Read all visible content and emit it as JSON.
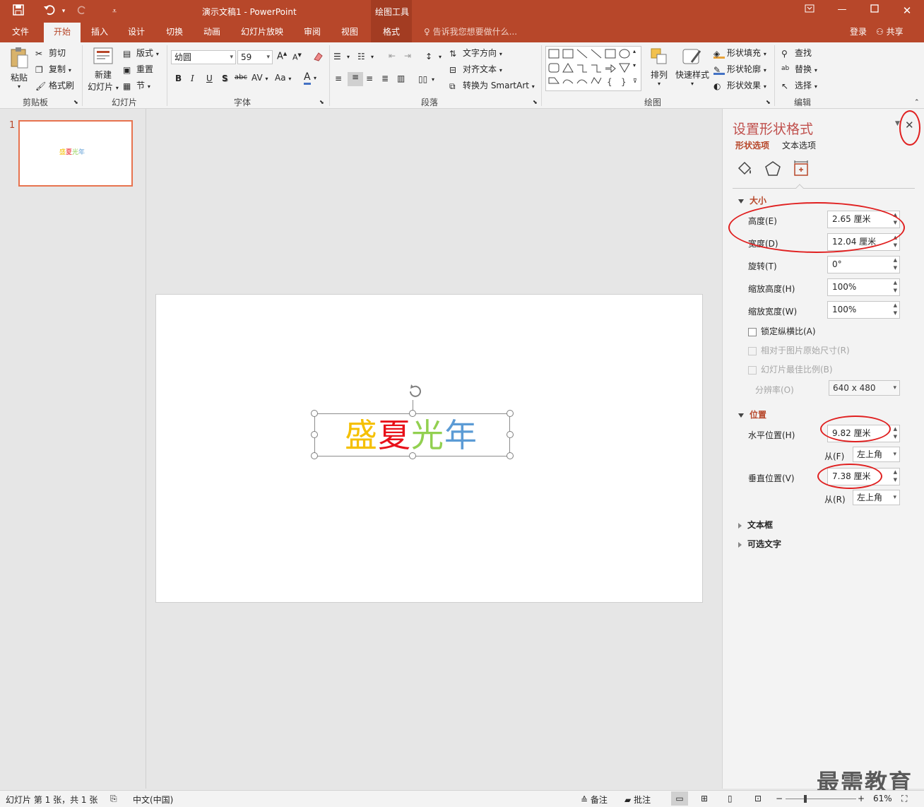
{
  "window": {
    "title": "演示文稿1 - PowerPoint",
    "context_tool": "绘图工具"
  },
  "tabs": [
    "文件",
    "开始",
    "插入",
    "设计",
    "切换",
    "动画",
    "幻灯片放映",
    "审阅",
    "视图",
    "格式"
  ],
  "tell_me": "告诉我您想要做什么...",
  "login": "登录",
  "share": "共享",
  "ribbon": {
    "clipboard": {
      "label": "剪贴板",
      "paste": "粘贴",
      "cut": "剪切",
      "copy": "复制",
      "painter": "格式刷"
    },
    "slides": {
      "label": "幻灯片",
      "new_slide_1": "新建",
      "new_slide_2": "幻灯片",
      "layout": "版式",
      "reset": "重置",
      "section": "节"
    },
    "font": {
      "label": "字体",
      "font_name": "幼圆",
      "font_size": "59",
      "bold": "B",
      "italic": "I",
      "underline": "U",
      "shadow": "S",
      "strike": "abc",
      "spacing": "AV",
      "case": "Aa",
      "color": "A"
    },
    "paragraph": {
      "label": "段落",
      "text_direction": "文字方向",
      "align_text": "对齐文本",
      "smartart": "转换为 SmartArt"
    },
    "drawing": {
      "label": "绘图",
      "arrange": "排列",
      "quick_styles": "快速样式",
      "fill": "形状填充",
      "outline": "形状轮廓",
      "effects": "形状效果"
    },
    "editing": {
      "label": "编辑",
      "find": "查找",
      "replace": "替换",
      "select": "选择"
    }
  },
  "thumbnail": {
    "number": "1"
  },
  "slide": {
    "chars": [
      {
        "text": "盛",
        "color": "#f5c000"
      },
      {
        "text": "夏",
        "color": "#e8111a"
      },
      {
        "text": "光",
        "color": "#92d050"
      },
      {
        "text": "年",
        "color": "#5b9bd5"
      }
    ]
  },
  "format_pane": {
    "title": "设置形状格式",
    "tab_shape": "形状选项",
    "tab_text": "文本选项",
    "size_section": "大小",
    "height_label": "高度(E)",
    "height_value": "2.65 厘米",
    "width_label": "宽度(D)",
    "width_value": "12.04 厘米",
    "rotation_label": "旋转(T)",
    "rotation_value": "0°",
    "scale_h_label": "缩放高度(H)",
    "scale_h_value": "100%",
    "scale_w_label": "缩放宽度(W)",
    "scale_w_value": "100%",
    "lock_ratio": "锁定纵横比(A)",
    "relative_original": "相对于图片原始尺寸(R)",
    "best_scale": "幻灯片最佳比例(B)",
    "resolution_label": "分辨率(O)",
    "resolution_value": "640 x 480",
    "position_section": "位置",
    "horiz_label": "水平位置(H)",
    "horiz_value": "9.82 厘米",
    "from_label_1": "从(F)",
    "from_value_1": "左上角",
    "vert_label": "垂直位置(V)",
    "vert_value": "7.38 厘米",
    "from_label_2": "从(R)",
    "from_value_2": "左上角",
    "textbox_section": "文本框",
    "alt_text_section": "可选文字"
  },
  "status": {
    "slide_info": "幻灯片 第 1 张，共 1 张",
    "language": "中文(中国)",
    "notes": "备注",
    "comments": "批注",
    "zoom": "61%"
  },
  "watermark": "最需教育",
  "colors": {
    "accent": "#b7472a",
    "pane_title": "#c0504d",
    "annotation": "#e02020"
  }
}
